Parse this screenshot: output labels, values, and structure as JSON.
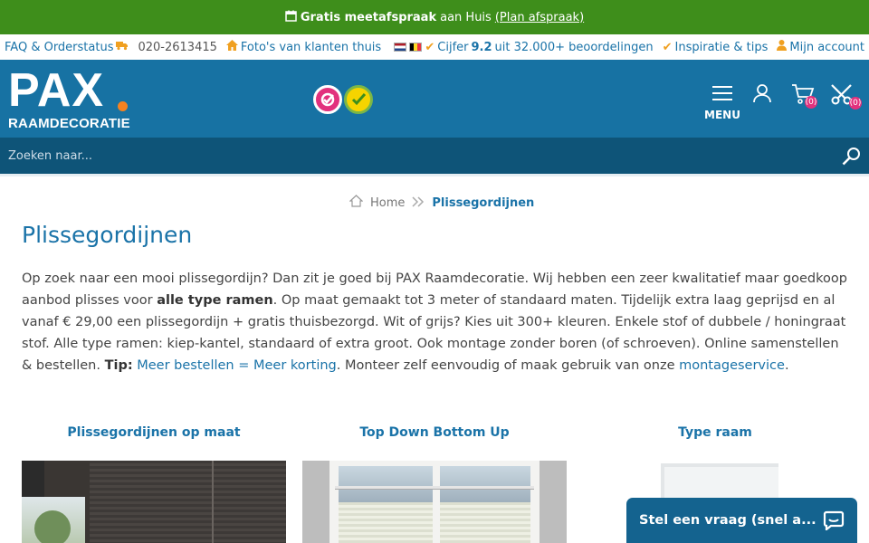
{
  "promo": {
    "icon": "calendar-icon",
    "bold_text": "Gratis meetafspraak",
    "text": "aan Huis",
    "link": "(Plan afspraak)"
  },
  "utility": {
    "faq": "FAQ & Orderstatus",
    "phone": "020-2613415",
    "photos": "Foto's van klanten thuis",
    "rating_prefix": "Cijfer",
    "rating_value": "9.2",
    "rating_suffix": "uit 32.000+ beoordelingen",
    "inspiration": "Inspiratie & tips",
    "account": "Mijn account"
  },
  "header": {
    "logo_text": "PAX",
    "logo_subtitle": "RAAMDECORATIE",
    "menu_label": "MENU",
    "cart_count": "(0)",
    "samples_count": "(0)"
  },
  "search": {
    "placeholder": "Zoeken naar..."
  },
  "breadcrumb": {
    "home": "Home",
    "current": "Plissegordijnen"
  },
  "page": {
    "title": "Plissegordijnen",
    "intro_1": "Op zoek naar een mooi plissegordijn? Dan zit je goed bij PAX Raamdecoratie. Wij hebben een zeer kwalitatief maar goedkoop aanbod plisses voor ",
    "intro_bold_1": "alle type ramen",
    "intro_2": ". Op maat gemaakt tot 3 meter of standaard maten. Tijdelijk extra laag geprijsd en al vanaf € 29,00 een plissegordijn + gratis thuisbezorgd. Wit of grijs? Kies uit 300+ kleuren. Enkele stof of dubbele / honingraat stof. Alle type ramen: kiep-kantel, standaard of extra groot. Ook montage zonder boren (of schroeven). Online samenstellen & bestellen. ",
    "intro_bold_2": "Tip:",
    "intro_link_1": "Meer bestellen = Meer korting",
    "intro_3": ". Monteer zelf eenvoudig of maak gebruik van onze ",
    "intro_link_2": "montageservice",
    "intro_4": "."
  },
  "categories": [
    {
      "title": "Plissegordijnen op maat"
    },
    {
      "title": "Top Down Bottom Up"
    },
    {
      "title": "Type raam"
    }
  ],
  "chat": {
    "label": "Stel een vraag (snel a..."
  },
  "colors": {
    "promo_green": "#3e8e1b",
    "header_blue": "#1772a3",
    "search_blue": "#0e5478",
    "link_blue": "#1a73a8",
    "accent_orange": "#f58220",
    "badge_pink": "#e2317d"
  }
}
